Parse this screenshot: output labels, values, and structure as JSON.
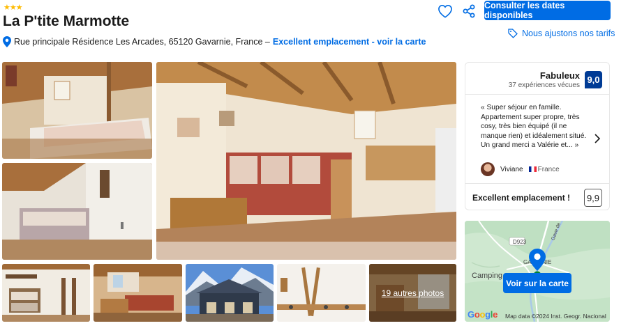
{
  "header": {
    "stars": "★★★",
    "hotel_name": "La P'tite Marmotte",
    "address": "Rue principale Résidence Les Arcades, 65120 Gavarnie, France –",
    "map_link": "Excellent emplacement - voir la carte",
    "cta_label": "Consulter les dates disponibles",
    "price_match": "Nous ajustons nos tarifs"
  },
  "gallery": {
    "more_photos": "19 autres photos"
  },
  "review": {
    "rating_word": "Fabuleux",
    "review_count": "37 expériences vécues",
    "score": "9,0",
    "quote": "« Super séjour en famille. Appartement super propre, très cosy, très bien équipé (il ne manque rien) et idéalement situé. Un grand merci a Valérie et... »",
    "reviewer_name": "Viviane",
    "reviewer_country": "France",
    "location_label": "Excellent emplacement !",
    "location_score": "9,9"
  },
  "map": {
    "button_label": "Voir sur la carte",
    "road_label": "D923",
    "town_label": "GA",
    "town_label_right": "NIE",
    "camping_label": "Camping",
    "river_label": "Gave de",
    "google": "Google",
    "credit": "Map data ©2024 Inst. Geogr. Nacional"
  },
  "icons": {
    "heart": "heart-icon",
    "share": "share-icon",
    "tag": "tag-icon",
    "pin": "map-pin-icon"
  },
  "colors": {
    "brand_blue": "#006ce4",
    "score_blue": "#003b95",
    "star_yellow": "#febb02"
  }
}
